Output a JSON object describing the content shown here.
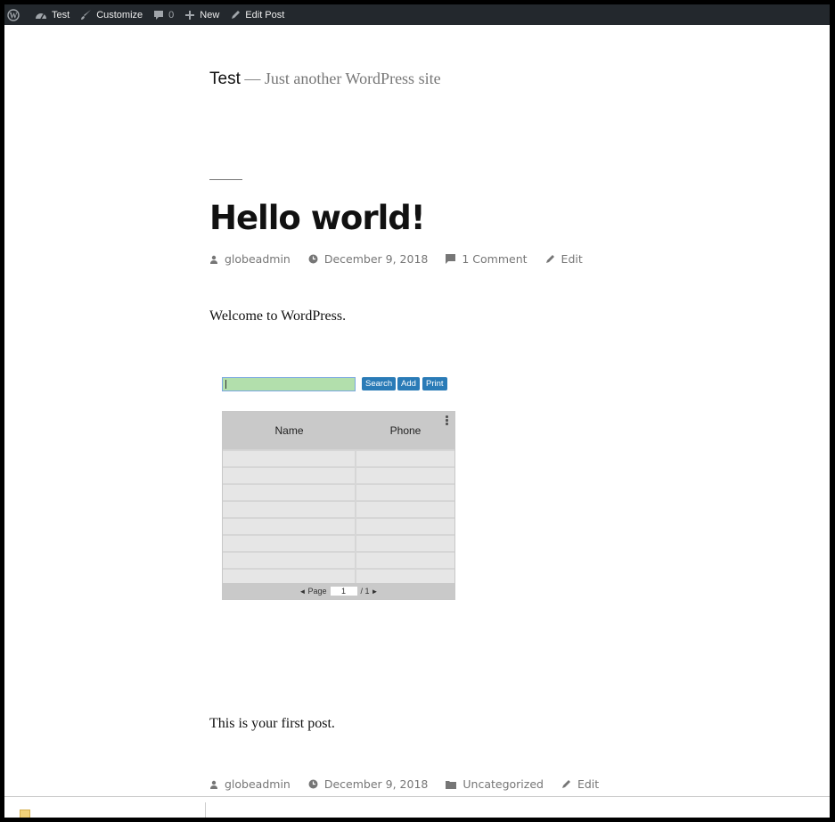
{
  "admin_bar": {
    "items": [
      {
        "icon": "wordpress-logo-icon",
        "label": ""
      },
      {
        "icon": "dashboard-icon",
        "label": "Test"
      },
      {
        "icon": "brush-icon",
        "label": "Customize"
      },
      {
        "icon": "comment-icon",
        "label": "0"
      },
      {
        "icon": "plus-icon",
        "label": "New"
      },
      {
        "icon": "pencil-icon",
        "label": "Edit Post"
      }
    ]
  },
  "site": {
    "title": "Test",
    "separator": " — ",
    "description": "Just another WordPress site"
  },
  "post": {
    "title": "Hello world!",
    "meta_top": {
      "author": "globeadmin",
      "date": "December 9, 2018",
      "comments": "1 Comment",
      "edit": "Edit"
    },
    "paragraph1": "Welcome to WordPress.",
    "paragraph2": "This is your first post.",
    "meta_bottom": {
      "author": "globeadmin",
      "date": "December 9, 2018",
      "category": "Uncategorized",
      "edit": "Edit"
    }
  },
  "grid": {
    "search_value": "",
    "buttons": {
      "search": "Search",
      "add": "Add",
      "print": "Print"
    },
    "columns": [
      "Name",
      "Phone"
    ],
    "rows": [
      [
        "",
        ""
      ],
      [
        "",
        ""
      ],
      [
        "",
        ""
      ],
      [
        "",
        ""
      ],
      [
        "",
        ""
      ],
      [
        "",
        ""
      ],
      [
        "",
        ""
      ],
      [
        "",
        ""
      ]
    ],
    "pager": {
      "prev": "◄",
      "label": "Page",
      "current": "1",
      "total": "/ 1",
      "next": "►"
    }
  }
}
